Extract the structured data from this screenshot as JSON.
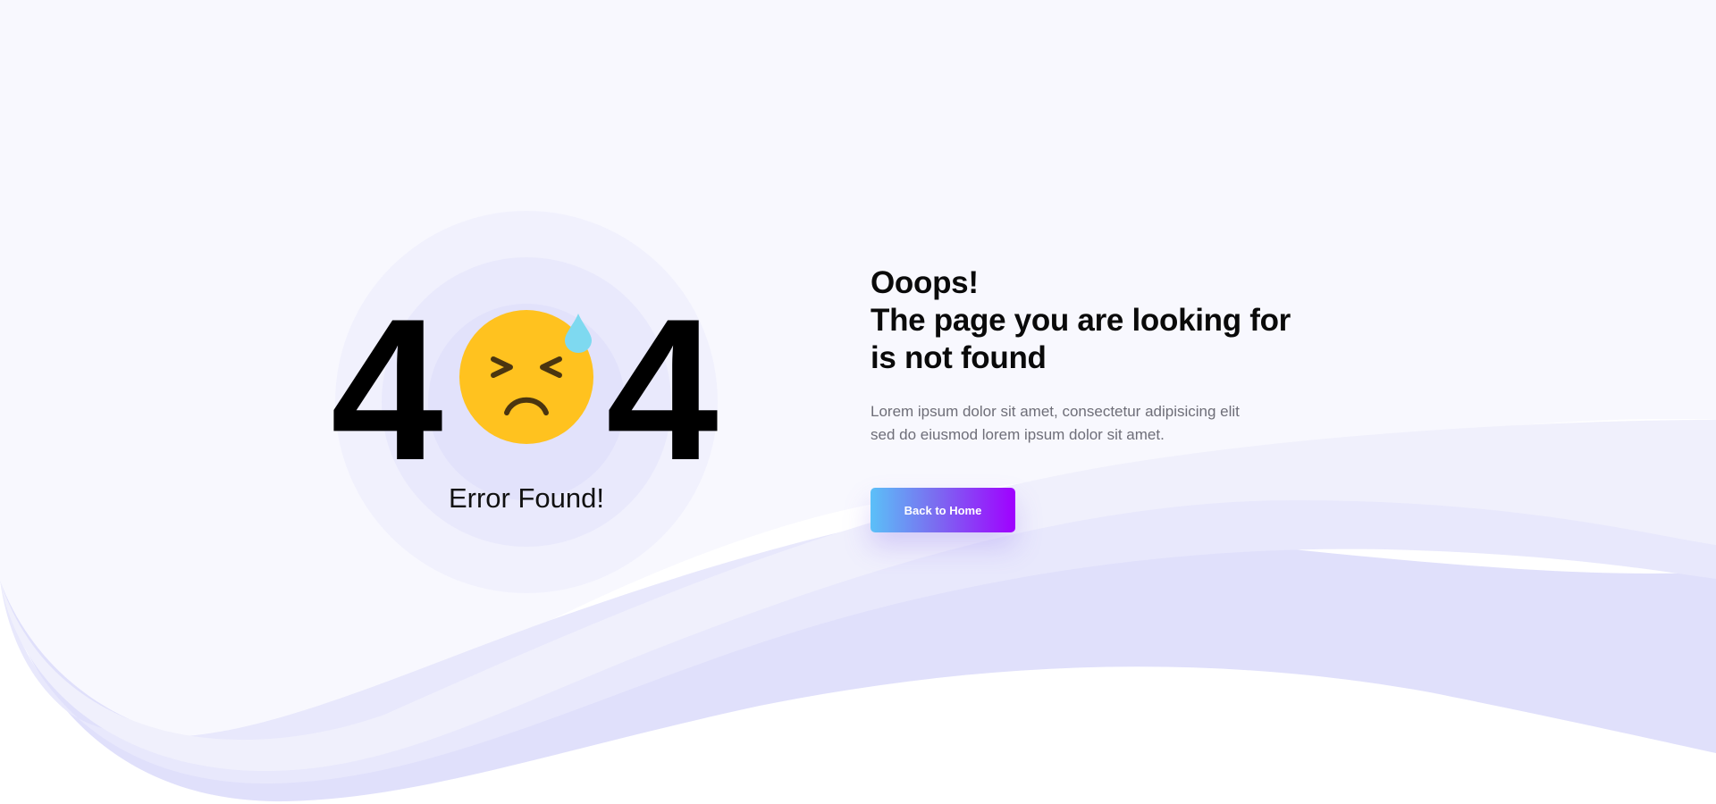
{
  "error": {
    "code_left_digit": "4",
    "code_right_digit": "4",
    "emoji_icon": "sad-sweat-face-icon",
    "caption": "Error Found!"
  },
  "message": {
    "headline_line1": "Ooops!",
    "headline_line2": "The page you are looking for",
    "headline_line3": "is not found",
    "description_line1": "Lorem ipsum dolor sit amet, consectetur adipisicing elit",
    "description_line2": "sed do eiusmod lorem ipsum dolor sit amet."
  },
  "actions": {
    "back_home_label": "Back to Home"
  },
  "colors": {
    "page_background": "#f8f8fe",
    "wave_light": "#f0f0fc",
    "wave_mid": "#e8e8fc",
    "wave_dark": "#e0e0fb",
    "emoji_face": "#ffc21f",
    "emoji_features": "#4a3510",
    "sweat_drop": "#7ed9f0",
    "button_gradient_start": "#5bc0f8",
    "button_gradient_end": "#a000ff"
  }
}
